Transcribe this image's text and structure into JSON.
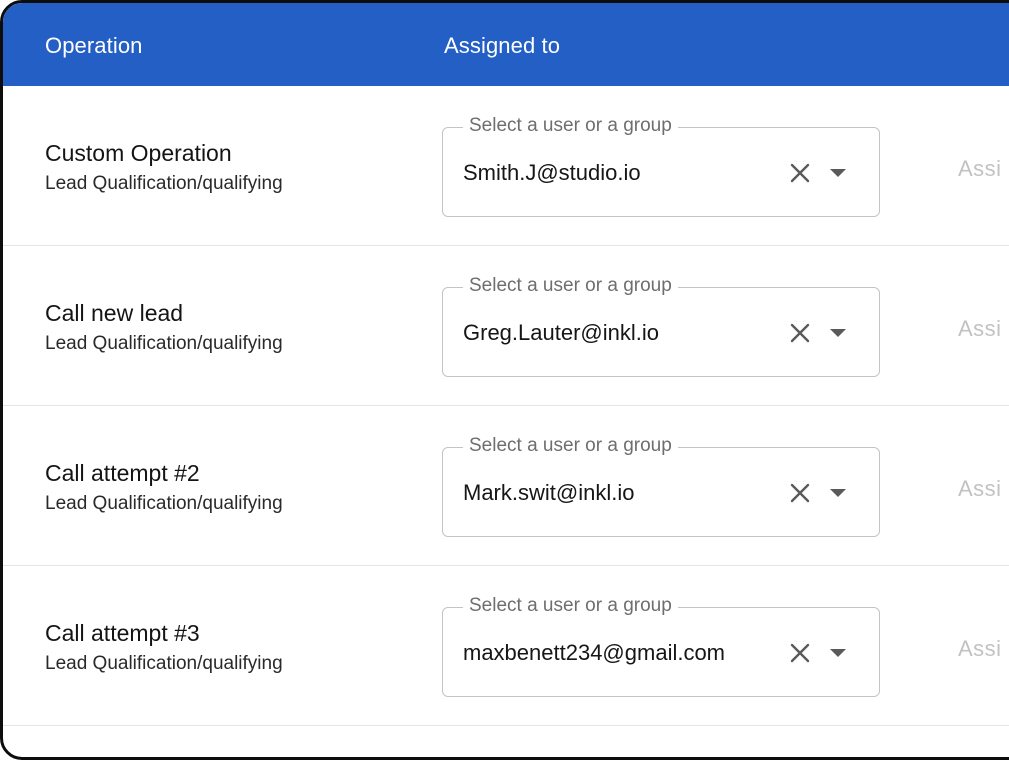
{
  "header": {
    "operation_label": "Operation",
    "assigned_label": "Assigned to",
    "background_color": "#245fc6"
  },
  "rows": [
    {
      "title": "Custom Operation",
      "subtitle": "Lead Qualification/qualifying",
      "field_label": "Select a user or a group",
      "value": "Smith.J@studio.io",
      "action_label": "Assi"
    },
    {
      "title": "Call new lead",
      "subtitle": "Lead Qualification/qualifying",
      "field_label": "Select a user or a group",
      "value": "Greg.Lauter@inkl.io",
      "action_label": "Assi"
    },
    {
      "title": "Call attempt #2",
      "subtitle": "Lead Qualification/qualifying",
      "field_label": "Select a user or a group",
      "value": "Mark.swit@inkl.io",
      "action_label": "Assi"
    },
    {
      "title": "Call attempt #3",
      "subtitle": "Lead Qualification/qualifying",
      "field_label": "Select a user or a group",
      "value": "maxbenett234@gmail.com",
      "action_label": "Assi"
    }
  ],
  "icons": {
    "clear": "close-icon",
    "dropdown": "caret-down-icon"
  }
}
